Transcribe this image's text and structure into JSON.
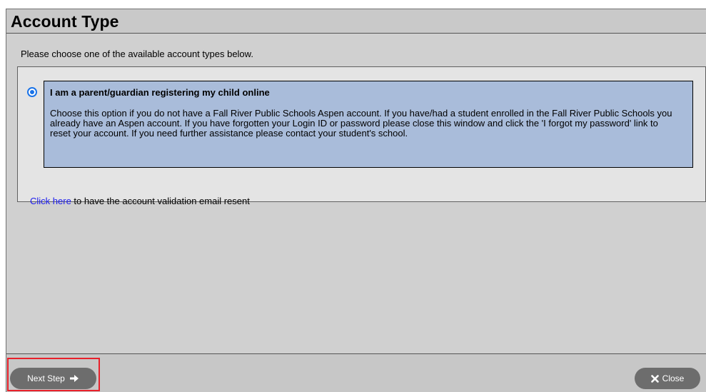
{
  "dialog": {
    "title": "Account Type",
    "intro": "Please choose one of the available account types below.",
    "options": [
      {
        "selected": true,
        "title": "I am a parent/guardian registering my child online",
        "description": "Choose this option if you do not have a Fall River Public Schools Aspen account. If you have/had a student enrolled in the Fall River Public Schools you already have an Aspen account. If you have forgotten your Login ID or password please close this window and click the 'I forgot my password' link to reset your account. If you need further assistance please contact your student's school."
      }
    ],
    "resend": {
      "link_text": "Click here",
      "rest_text": " to have the account validation email resent"
    }
  },
  "footer": {
    "next_label": "Next Step",
    "next_icon": "arrow-right-icon",
    "close_label": "Close",
    "close_icon": "close-icon"
  },
  "colors": {
    "selected_option_bg": "#a9bcda",
    "radio_accent": "#1a73e8",
    "link": "#1a1aee",
    "button_bg": "#6d6d6d",
    "highlight": "#e8202a"
  }
}
